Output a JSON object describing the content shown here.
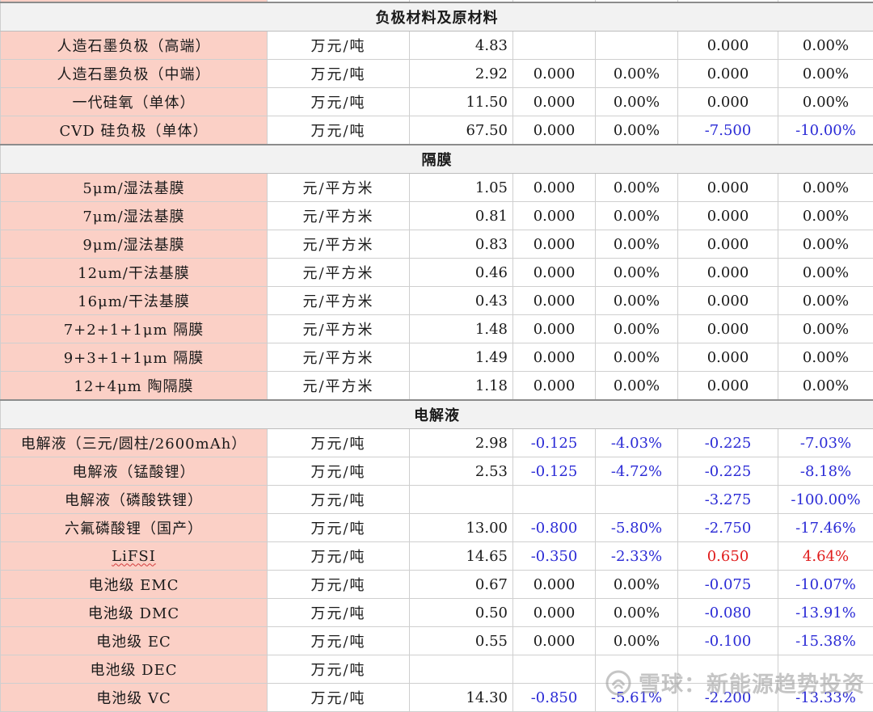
{
  "sections": [
    {
      "title": "负极材料及原材料",
      "rows": [
        {
          "name": "人造石墨负极（高端）",
          "unit": "万元/吨",
          "price": "4.83",
          "c1": "",
          "p1": "",
          "c2": "0.000",
          "p2": "0.00%",
          "c1_color": "",
          "p1_color": "",
          "c2_color": "",
          "p2_color": ""
        },
        {
          "name": "人造石墨负极（中端）",
          "unit": "万元/吨",
          "price": "2.92",
          "c1": "0.000",
          "p1": "0.00%",
          "c2": "0.000",
          "p2": "0.00%",
          "c1_color": "",
          "p1_color": "",
          "c2_color": "",
          "p2_color": ""
        },
        {
          "name": "一代硅氧（单体）",
          "unit": "万元/吨",
          "price": "11.50",
          "c1": "0.000",
          "p1": "0.00%",
          "c2": "0.000",
          "p2": "0.00%",
          "c1_color": "",
          "p1_color": "",
          "c2_color": "",
          "p2_color": ""
        },
        {
          "name": "CVD 硅负极（单体）",
          "unit": "万元/吨",
          "price": "67.50",
          "c1": "0.000",
          "p1": "0.00%",
          "c2": "-7.500",
          "p2": "-10.00%",
          "c1_color": "",
          "p1_color": "",
          "c2_color": "blue",
          "p2_color": "blue"
        }
      ]
    },
    {
      "title": "隔膜",
      "rows": [
        {
          "name": "5μm/湿法基膜",
          "unit": "元/平方米",
          "price": "1.05",
          "c1": "0.000",
          "p1": "0.00%",
          "c2": "0.000",
          "p2": "0.00%",
          "c1_color": "",
          "p1_color": "",
          "c2_color": "",
          "p2_color": ""
        },
        {
          "name": "7μm/湿法基膜",
          "unit": "元/平方米",
          "price": "0.81",
          "c1": "0.000",
          "p1": "0.00%",
          "c2": "0.000",
          "p2": "0.00%",
          "c1_color": "",
          "p1_color": "",
          "c2_color": "",
          "p2_color": ""
        },
        {
          "name": "9μm/湿法基膜",
          "unit": "元/平方米",
          "price": "0.83",
          "c1": "0.000",
          "p1": "0.00%",
          "c2": "0.000",
          "p2": "0.00%",
          "c1_color": "",
          "p1_color": "",
          "c2_color": "",
          "p2_color": ""
        },
        {
          "name": "12um/干法基膜",
          "unit": "元/平方米",
          "price": "0.46",
          "c1": "0.000",
          "p1": "0.00%",
          "c2": "0.000",
          "p2": "0.00%",
          "c1_color": "",
          "p1_color": "",
          "c2_color": "",
          "p2_color": ""
        },
        {
          "name": "16μm/干法基膜",
          "unit": "元/平方米",
          "price": "0.43",
          "c1": "0.000",
          "p1": "0.00%",
          "c2": "0.000",
          "p2": "0.00%",
          "c1_color": "",
          "p1_color": "",
          "c2_color": "",
          "p2_color": ""
        },
        {
          "name": "7+2+1+1μm 隔膜",
          "unit": "元/平方米",
          "price": "1.48",
          "c1": "0.000",
          "p1": "0.00%",
          "c2": "0.000",
          "p2": "0.00%",
          "c1_color": "",
          "p1_color": "",
          "c2_color": "",
          "p2_color": ""
        },
        {
          "name": "9+3+1+1μm 隔膜",
          "unit": "元/平方米",
          "price": "1.49",
          "c1": "0.000",
          "p1": "0.00%",
          "c2": "0.000",
          "p2": "0.00%",
          "c1_color": "",
          "p1_color": "",
          "c2_color": "",
          "p2_color": ""
        },
        {
          "name": "12+4μm 陶隔膜",
          "unit": "元/平方米",
          "price": "1.18",
          "c1": "0.000",
          "p1": "0.00%",
          "c2": "0.000",
          "p2": "0.00%",
          "c1_color": "",
          "p1_color": "",
          "c2_color": "",
          "p2_color": ""
        }
      ]
    },
    {
      "title": "电解液",
      "rows": [
        {
          "name": "电解液（三元/圆柱/2600mAh）",
          "unit": "万元/吨",
          "price": "2.98",
          "c1": "-0.125",
          "p1": "-4.03%",
          "c2": "-0.225",
          "p2": "-7.03%",
          "c1_color": "blue",
          "p1_color": "blue",
          "c2_color": "blue",
          "p2_color": "blue"
        },
        {
          "name": "电解液（锰酸锂）",
          "unit": "万元/吨",
          "price": "2.53",
          "c1": "-0.125",
          "p1": "-4.72%",
          "c2": "-0.225",
          "p2": "-8.18%",
          "c1_color": "blue",
          "p1_color": "blue",
          "c2_color": "blue",
          "p2_color": "blue"
        },
        {
          "name": "电解液（磷酸铁锂）",
          "unit": "万元/吨",
          "price": "",
          "c1": "",
          "p1": "",
          "c2": "-3.275",
          "p2": "-100.00%",
          "c1_color": "",
          "p1_color": "",
          "c2_color": "blue",
          "p2_color": "blue"
        },
        {
          "name": "六氟磷酸锂（国产）",
          "unit": "万元/吨",
          "price": "13.00",
          "c1": "-0.800",
          "p1": "-5.80%",
          "c2": "-2.750",
          "p2": "-17.46%",
          "c1_color": "blue",
          "p1_color": "blue",
          "c2_color": "blue",
          "p2_color": "blue"
        },
        {
          "name": "LiFSI",
          "unit": "万元/吨",
          "price": "14.65",
          "c1": "-0.350",
          "p1": "-2.33%",
          "c2": "0.650",
          "p2": "4.64%",
          "c1_color": "blue",
          "p1_color": "blue",
          "c2_color": "red",
          "p2_color": "red",
          "wavy": true
        },
        {
          "name": "电池级 EMC",
          "unit": "万元/吨",
          "price": "0.67",
          "c1": "0.000",
          "p1": "0.00%",
          "c2": "-0.075",
          "p2": "-10.07%",
          "c1_color": "",
          "p1_color": "",
          "c2_color": "blue",
          "p2_color": "blue"
        },
        {
          "name": "电池级 DMC",
          "unit": "万元/吨",
          "price": "0.50",
          "c1": "0.000",
          "p1": "0.00%",
          "c2": "-0.080",
          "p2": "-13.91%",
          "c1_color": "",
          "p1_color": "",
          "c2_color": "blue",
          "p2_color": "blue"
        },
        {
          "name": "电池级 EC",
          "unit": "万元/吨",
          "price": "0.55",
          "c1": "0.000",
          "p1": "0.00%",
          "c2": "-0.100",
          "p2": "-15.38%",
          "c1_color": "",
          "p1_color": "",
          "c2_color": "blue",
          "p2_color": "blue"
        },
        {
          "name": "电池级 DEC",
          "unit": "万元/吨",
          "price": "",
          "c1": "",
          "p1": "",
          "c2": "",
          "p2": "",
          "c1_color": "",
          "p1_color": "",
          "c2_color": "",
          "p2_color": ""
        },
        {
          "name": "电池级 VC",
          "unit": "万元/吨",
          "price": "14.30",
          "c1": "-0.850",
          "p1": "-5.61%",
          "c2": "-2.200",
          "p2": "-13.33%",
          "c1_color": "blue",
          "p1_color": "blue",
          "c2_color": "blue",
          "p2_color": "blue"
        }
      ]
    }
  ],
  "watermark": {
    "text": "雪球：新能源趋势投资",
    "icon": "snowball-logo-icon"
  },
  "colors": {
    "name_bg": "#fbd0c6",
    "negative": "#2b2bd6",
    "positive": "#e01b1b",
    "section_bg": "#f2f2f2"
  }
}
